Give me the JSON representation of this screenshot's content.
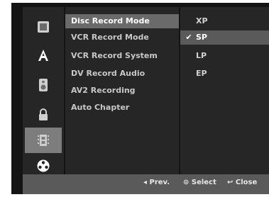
{
  "sidebar": {
    "items": [
      {
        "icon": "disc-icon"
      },
      {
        "icon": "font-a-icon"
      },
      {
        "icon": "speaker-icon"
      },
      {
        "icon": "lock-icon"
      },
      {
        "icon": "film-icon",
        "active": true
      },
      {
        "icon": "reel-icon"
      }
    ]
  },
  "menu": {
    "items": [
      {
        "label": "Disc Record Mode",
        "active": true
      },
      {
        "label": "VCR Record Mode"
      },
      {
        "label": "VCR Record System"
      },
      {
        "label": "DV Record Audio"
      },
      {
        "label": "AV2 Recording"
      },
      {
        "label": "Auto Chapter"
      }
    ]
  },
  "options": {
    "items": [
      {
        "label": "XP"
      },
      {
        "label": "SP",
        "selected": true,
        "check": "✔"
      },
      {
        "label": "LP"
      },
      {
        "label": "EP"
      }
    ]
  },
  "footer": {
    "prev": "◂ Prev.",
    "select": "⊙ Select",
    "close": "↩ Close"
  }
}
